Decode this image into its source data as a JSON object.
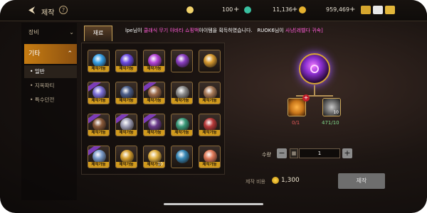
{
  "header": {
    "back_icon": "arrow-left-icon",
    "title": "제작",
    "help": "?"
  },
  "currencies": [
    {
      "value": "100",
      "icon": "c-coin-icon",
      "color": "#f2d36b"
    },
    {
      "value": "11,136",
      "icon": "green-gem-icon",
      "color": "#39c0a0"
    },
    {
      "value": "959,469",
      "icon": "gold-coin-icon",
      "color": "#e5b12e"
    }
  ],
  "top_icons": [
    "treasure-chest-icon",
    "mail-icon",
    "chat-icon"
  ],
  "sidebar": {
    "equip_label": "장비",
    "other_label": "기타",
    "subs": [
      "일반",
      "지옥파티",
      "특수던전"
    ]
  },
  "grid": {
    "tab": "재료",
    "craftable_label": "제작가능",
    "items": [
      {
        "color": "#37a0e6",
        "lab": true,
        "rib": false,
        "cnt": ""
      },
      {
        "color": "#6b4be0",
        "lab": true,
        "rib": false,
        "cnt": ""
      },
      {
        "color": "#b444d8",
        "lab": true,
        "rib": false,
        "cnt": ""
      },
      {
        "color": "#8a3ec2",
        "lab": false,
        "rib": false,
        "cnt": ""
      },
      {
        "color": "#d79a30",
        "lab": false,
        "rib": false,
        "cnt": ""
      },
      {
        "color": "#7c70d8",
        "lab": true,
        "rib": true,
        "cnt": ""
      },
      {
        "color": "#4a5d88",
        "lab": true,
        "rib": false,
        "cnt": ""
      },
      {
        "color": "#9c6a4a",
        "lab": true,
        "rib": true,
        "cnt": ""
      },
      {
        "color": "#8c8c8c",
        "lab": true,
        "rib": false,
        "cnt": ""
      },
      {
        "color": "#a87a58",
        "lab": true,
        "rib": false,
        "cnt": ""
      },
      {
        "color": "#8a5a3a",
        "lab": true,
        "rib": true,
        "cnt": ""
      },
      {
        "color": "#a0a0b8",
        "lab": true,
        "rib": true,
        "cnt": ""
      },
      {
        "color": "#6a3a8a",
        "lab": true,
        "rib": true,
        "cnt": ""
      },
      {
        "color": "#3a9a7a",
        "lab": true,
        "rib": false,
        "cnt": ""
      },
      {
        "color": "#b83a3a",
        "lab": true,
        "rib": false,
        "cnt": ""
      },
      {
        "color": "#7a9ac8",
        "lab": true,
        "rib": true,
        "cnt": ""
      },
      {
        "color": "#d6a030",
        "lab": true,
        "rib": false,
        "cnt": ""
      },
      {
        "color": "#e0b040",
        "lab": true,
        "rib": false,
        "cnt": "10"
      },
      {
        "color": "#3a8ab8",
        "lab": false,
        "rib": false,
        "cnt": ""
      },
      {
        "color": "#e07a5a",
        "lab": true,
        "rib": false,
        "cnt": ""
      }
    ]
  },
  "ticker": {
    "p1": "lpe님이 ",
    "p2": "클래식 무기 아바타 쇼핑백",
    "p3": "아이템을 획득하였습니다.",
    "p4": "RUOK6님이 ",
    "p5": "사냥[레벨다 귀속]"
  },
  "craft": {
    "materials": [
      {
        "count": "0/1",
        "color": "#e65a5a"
      },
      {
        "count": "471/10",
        "color": "#7fd68a"
      }
    ],
    "mat2_stack": "10",
    "qty_label": "수량",
    "minus": "−",
    "plus": "+",
    "qty_value": "1",
    "cost_label": "제작 비용",
    "cost_value": "1,300",
    "craft_button": "제작"
  }
}
